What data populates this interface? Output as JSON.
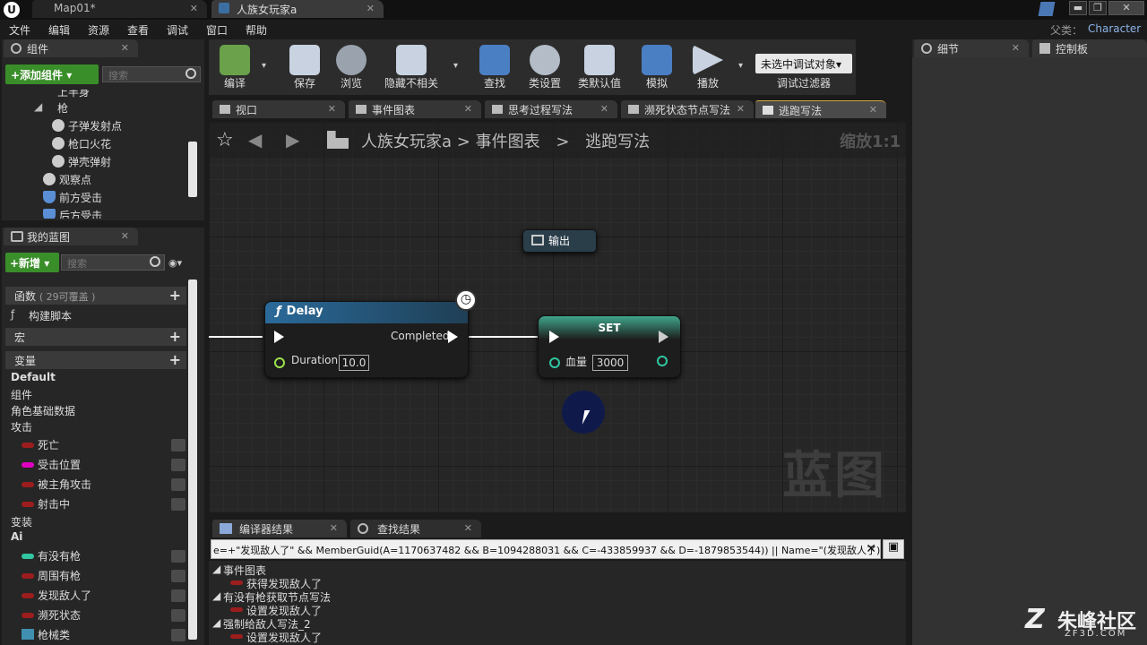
{
  "window": {
    "tab_map": "Map01*",
    "tab_blueprint": "人族女玩家a",
    "parent_label": "父类：",
    "parent_value": "Character",
    "win_min": "▬",
    "win_max": "❐",
    "win_close": "✕"
  },
  "menu": [
    "文件",
    "编辑",
    "资源",
    "查看",
    "调试",
    "窗口",
    "帮助"
  ],
  "components": {
    "tab": "组件",
    "add_button": "+添加组件 ▾",
    "search_placeholder": "搜索",
    "items": [
      "上半身",
      "枪",
      "子弹发射点",
      "枪口火花",
      "弹壳弹射",
      "观察点",
      "前方受击",
      "后方受击"
    ]
  },
  "mybp": {
    "tab": "我的蓝图",
    "new_button": "+新增 ▾",
    "search_placeholder": "搜索",
    "functions_label": "函数",
    "functions_count": "( 29可覆盖 )",
    "construct": "构建脚本",
    "macros": "宏",
    "variables": "变量",
    "cat_default": "Default",
    "cat_components": "组件",
    "cat_character": "角色基础数据",
    "cat_attack": "攻击",
    "attack_vars": [
      "死亡",
      "受击位置",
      "被主角攻击",
      "射击中"
    ],
    "cat_change": "变装",
    "cat_ai": "Ai",
    "ai_vars": [
      "有没有枪",
      "周围有枪",
      "发现敌人了",
      "濒死状态",
      "枪械类"
    ]
  },
  "toolbar": {
    "buttons": [
      "编译",
      "保存",
      "浏览",
      "隐藏不相关",
      "查找",
      "类设置",
      "类默认值",
      "模拟",
      "播放"
    ],
    "debug_select": "未选中调试对象▾",
    "debug_filter": "调试过滤器"
  },
  "doc_tabs": [
    "视口",
    "事件图表",
    "思考过程写法",
    "濒死状态节点写法",
    "逃跑写法"
  ],
  "breadcrumb": {
    "root": "人族女玩家a",
    "sep1": ">",
    "mid": "事件图表",
    "sep2": ">",
    "current": "逃跑写法",
    "zoom": "缩放1:1"
  },
  "graph": {
    "output_node": "输出",
    "delay_title": "Delay",
    "delay_completed": "Completed",
    "delay_duration_label": "Duration",
    "delay_duration_value": "10.0",
    "set_title": "SET",
    "set_var_label": "血量",
    "set_var_value": "3000",
    "watermark": "蓝图"
  },
  "right_panels": {
    "details_tab": "细节",
    "control_tab": "控制板"
  },
  "bottom": {
    "tab_compiler": "编译器结果",
    "tab_find": "查找结果",
    "search_query": "e=+\"发现敌人了\" && MemberGuid(A=1170637482 && B=1094288031 && C=-433859937 && D=-1879853544)) || Name=\"(发现敌人了)\")",
    "results": [
      {
        "group": "事件图表",
        "item": "获得发现敌人了"
      },
      {
        "group": "有没有枪获取节点写法",
        "item": "设置发现敌人了"
      },
      {
        "group": "强制给敌人写法_2",
        "item": "设置发现敌人了"
      }
    ]
  },
  "brand": {
    "name": "朱峰社区",
    "url": "ZF3D.COM"
  },
  "colors": {
    "var_red": "#9c1d1d",
    "var_pink": "#e000c0",
    "var_teal": "#2fc6a0",
    "add_green": "#3a8e2a",
    "exec_white": "#ffffff",
    "pin_green": "#9ce34c"
  }
}
